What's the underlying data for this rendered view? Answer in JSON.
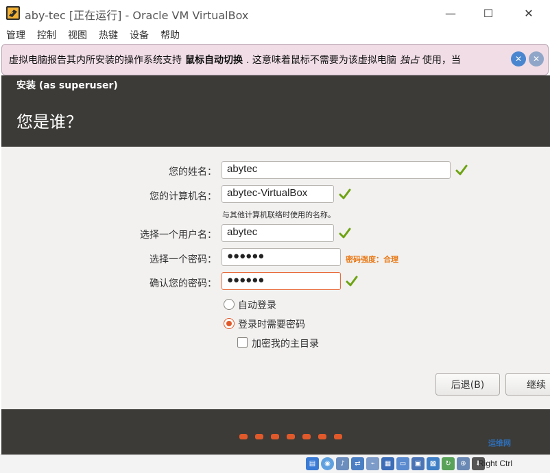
{
  "window": {
    "title": "aby-tec [正在运行] - Oracle VM VirtualBox",
    "minimize": "—",
    "maximize": "☐",
    "close": "✕"
  },
  "menu": [
    "管理",
    "控制",
    "视图",
    "热键",
    "设备",
    "帮助"
  ],
  "notice": {
    "text_before": "虚拟电脑报告其内所安装的操作系统支持",
    "bold": "鼠标自动切换",
    "text_middle": ". 这意味着鼠标不需要为该虚拟电脑",
    "italic": "独占",
    "text_after": "使用，当"
  },
  "installer": {
    "crumb": "安装 (as superuser)",
    "title": "您是谁？"
  },
  "form": {
    "name_label": "您的姓名：",
    "name_value": "abytec",
    "computer_label": "您的计算机名：",
    "computer_value": "abytec-VirtualBox",
    "computer_hint": "与其他计算机联络时使用的名称。",
    "username_label": "选择一个用户名：",
    "username_value": "abytec",
    "password_label": "选择一个密码：",
    "password_value": "●●●●●●",
    "strength": "密码强度：合理",
    "confirm_label": "确认您的密码：",
    "confirm_value": "●●●●●●",
    "auto_login": "自动登录",
    "require_password": "登录时需要密码",
    "encrypt_home": "加密我的主目录",
    "login_mode_selected": "require_password",
    "encrypt_home_checked": false
  },
  "buttons": {
    "back": "后退(B)",
    "continue": "继续"
  },
  "progress": {
    "steps": 7
  },
  "statusbar": {
    "host_key": "Right Ctrl"
  },
  "watermark": "运维网",
  "colors": {
    "accent": "#e0592a",
    "check": "#6ea312",
    "header_bg": "#3c3b37",
    "notice_bg": "#f0dde6"
  }
}
